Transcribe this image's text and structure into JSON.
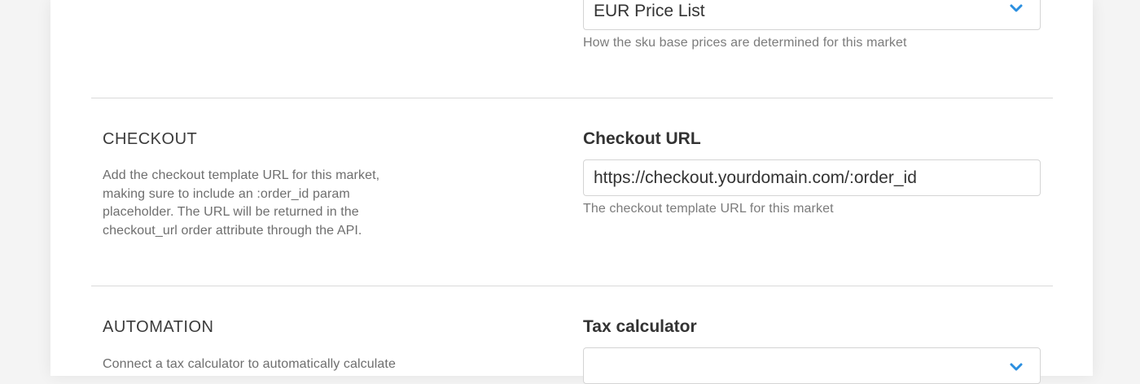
{
  "pricing": {
    "price_list_value": "EUR Price List",
    "price_list_help": "How the sku base prices are determined for this market"
  },
  "checkout": {
    "title": "CHECKOUT",
    "description": "Add the checkout template URL for this market, making sure to include an :order_id param placeholder. The URL will be returned in the checkout_url order attribute through the API.",
    "field_label": "Checkout URL",
    "url_value": "https://checkout.yourdomain.com/:order_id",
    "field_help": "The checkout template URL for this market"
  },
  "automation": {
    "title": "AUTOMATION",
    "description": "Connect a tax calculator to automatically calculate",
    "field_label": "Tax calculator",
    "tax_calculator_value": ""
  },
  "icons": {
    "dropdown": "chevron-down-icon"
  },
  "colors": {
    "accent": "#2b8fe0",
    "background": "#f4f4f4",
    "card": "#ffffff",
    "divider": "#dadada",
    "help_text": "#7b7b7b"
  }
}
